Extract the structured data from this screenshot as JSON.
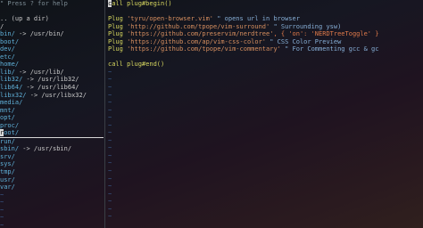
{
  "tree": {
    "help_line": "\" Press ? for help",
    "blank": "",
    "up_line": ".. (up a dir)",
    "root": "/",
    "entries": [
      {
        "name": "bin/",
        "link": " -> /usr/bin/"
      },
      {
        "name": "boot/",
        "link": ""
      },
      {
        "name": "dev/",
        "link": ""
      },
      {
        "name": "etc/",
        "link": ""
      },
      {
        "name": "home/",
        "link": ""
      },
      {
        "name": "lib/",
        "link": " -> /usr/lib/"
      },
      {
        "name": "lib32/",
        "link": " -> /usr/lib32/"
      },
      {
        "name": "lib64/",
        "link": " -> /usr/lib64/"
      },
      {
        "name": "libx32/",
        "link": " -> /usr/libx32/"
      },
      {
        "name": "media/",
        "link": ""
      },
      {
        "name": "mnt/",
        "link": ""
      },
      {
        "name": "opt/",
        "link": ""
      },
      {
        "name": "proc/",
        "link": ""
      },
      {
        "name": "root/",
        "link": ""
      },
      {
        "name": "run/",
        "link": ""
      },
      {
        "name": "sbin/",
        "link": " -> /usr/sbin/"
      },
      {
        "name": "srv/",
        "link": ""
      },
      {
        "name": "sys/",
        "link": ""
      },
      {
        "name": "tmp/",
        "link": ""
      },
      {
        "name": "usr/",
        "link": ""
      },
      {
        "name": "var/",
        "link": ""
      }
    ]
  },
  "editor": {
    "line_begin": "call plug#begin()",
    "plugs": [
      {
        "cmd": "Plug ",
        "repo": "'tyru/open-browser.vim'",
        "opts": "",
        "comment": " \" opens url in browser"
      },
      {
        "cmd": "Plug ",
        "repo": "'http://github.com/tpope/vim-surround'",
        "opts": "",
        "comment": " \" Surrounding ysw)"
      },
      {
        "cmd": "Plug ",
        "repo": "'https://github.com/preservim/nerdtree'",
        "opts": ", { 'on': 'NERDTreeToggle' }",
        "comment": ""
      },
      {
        "cmd": "Plug ",
        "repo": "'https://github.com/ap/vim-css-color'",
        "opts": "",
        "comment": " \" CSS Color Preview"
      },
      {
        "cmd": "Plug ",
        "repo": "'https://github.com/tpope/vim-commentary'",
        "opts": "",
        "comment": " \" For Commenting gcc & gc"
      }
    ],
    "line_end": "call plug#end()",
    "tilde": "~",
    "cursor_char": "c"
  },
  "colors": {
    "directory": "#5fafd7",
    "keyword": "#d7d75f",
    "string": "#d78f5f",
    "comment": "#87afd7",
    "tilde": "#3a5a8a"
  }
}
